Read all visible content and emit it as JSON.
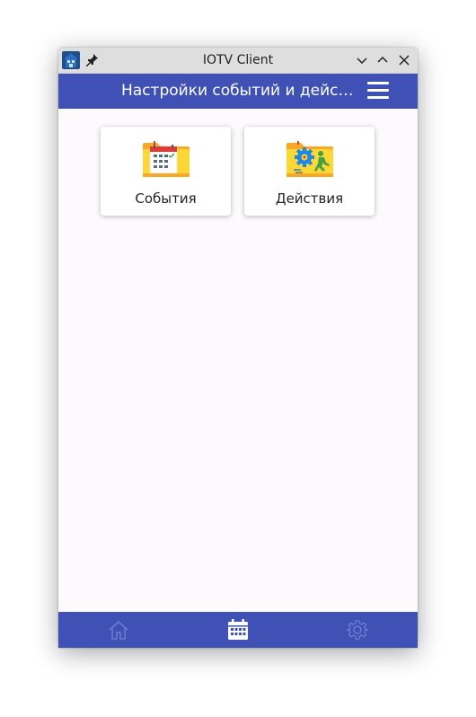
{
  "window": {
    "title": "IOTV Client"
  },
  "appbar": {
    "title": "Настройки событий и действий",
    "menu_icon": "hamburger-menu-icon"
  },
  "cards": [
    {
      "label": "События",
      "icon": "folder-calendar-icon"
    },
    {
      "label": "Действия",
      "icon": "folder-gear-runner-icon"
    }
  ],
  "pager": {
    "count": 3,
    "active_index": 1
  },
  "bottom_nav": {
    "items": [
      {
        "icon": "home-icon",
        "active": false
      },
      {
        "icon": "calendar-icon",
        "active": true
      },
      {
        "icon": "gear-icon",
        "active": false
      }
    ]
  },
  "colors": {
    "primary": "#3f51b5",
    "nav_inactive": "#6b7bd0",
    "nav_active": "#ffffff",
    "folder": "#fbc02d"
  }
}
